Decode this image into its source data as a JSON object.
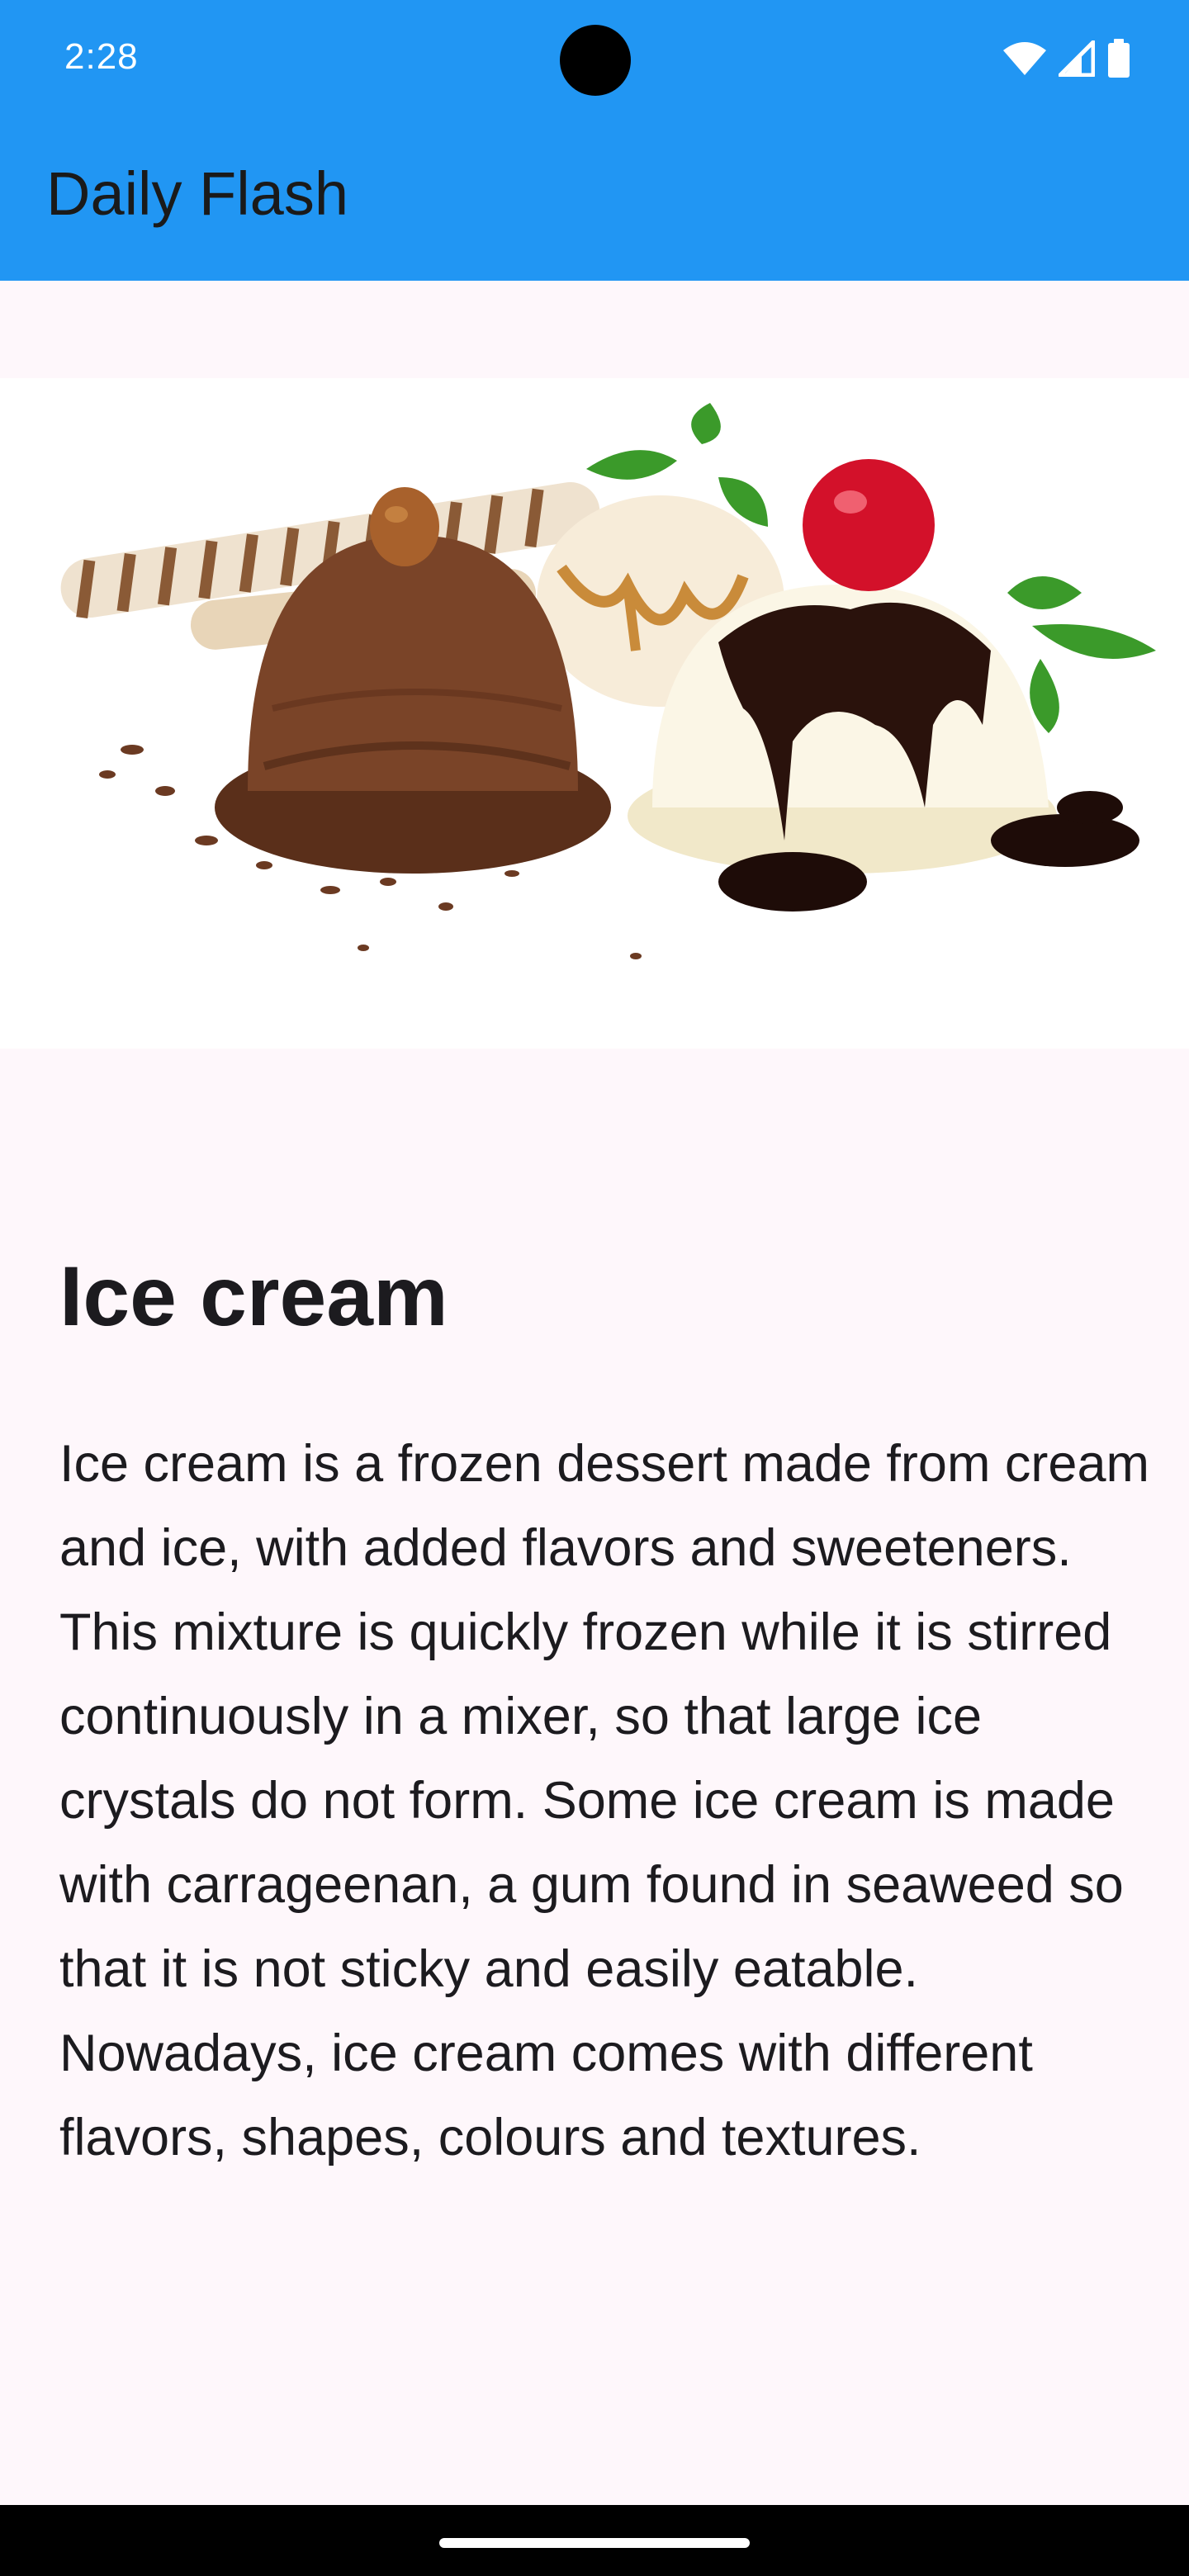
{
  "status_bar": {
    "time": "2:28",
    "icons": [
      "wifi-icon",
      "cellular-signal-icon",
      "battery-icon"
    ]
  },
  "app_bar": {
    "title": "Daily Flash",
    "color": "#2196F3"
  },
  "hero_image": {
    "icon": "ice-cream-image"
  },
  "article": {
    "title": "Ice cream",
    "body": "Ice cream is a frozen dessert made from cream and ice, with added flavors and sweeteners. This mixture is quickly frozen while it is stirred continuously in a mixer, so that large ice crystals do not form. Some ice cream is made with carrageenan, a gum found in seaweed so that it is not sticky and easily eatable. Nowadays, ice cream comes with different flavors, shapes, colours and textures."
  }
}
